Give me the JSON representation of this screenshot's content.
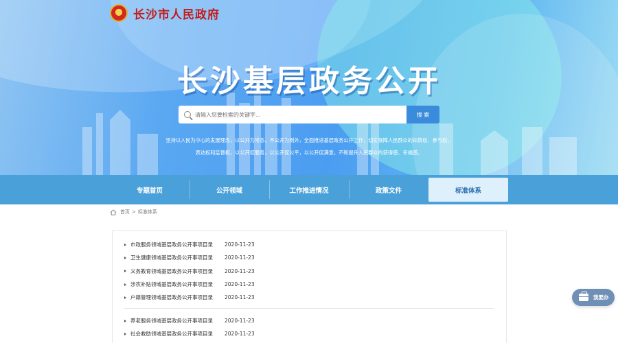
{
  "header": {
    "site_name": "长沙市人民政府",
    "headline": "长沙基层政务公开",
    "emblem_icon": "national-emblem-icon"
  },
  "search": {
    "placeholder": "请输入您要检索的关键字...",
    "button_label": "搜 索"
  },
  "motto": {
    "line1": "坚持以人民为中心的发展理念，以公开为常态，不公开为例外，全面推进基层政务公开工作，切实保障人民群众的知情权、参与权、",
    "line2": "表达权和监督权，以公开促服务，以公开促公平，以公开促满意，不断提升人民群众的获得感、幸福感。"
  },
  "nav": {
    "items": [
      {
        "label": "专题首页",
        "active": false
      },
      {
        "label": "公开领域",
        "active": false
      },
      {
        "label": "工作推进情况",
        "active": false
      },
      {
        "label": "政策文件",
        "active": false
      },
      {
        "label": "标准体系",
        "active": true
      }
    ]
  },
  "breadcrumb": {
    "home": "首页",
    "separator": ">",
    "current": "标准体系"
  },
  "list": {
    "group1": [
      {
        "title": "市政服务领域基层政务公开事项目录",
        "date": "2020-11-23"
      },
      {
        "title": "卫生健康领域基层政务公开事项目录",
        "date": "2020-11-23"
      },
      {
        "title": "义务教育领域基层政务公开事项目录",
        "date": "2020-11-23"
      },
      {
        "title": "涉农补贴领域基层政务公开事项目录",
        "date": "2020-11-23"
      },
      {
        "title": "户籍管理领域基层政务公开事项目录",
        "date": "2020-11-23"
      }
    ],
    "group2": [
      {
        "title": "养老服务领域基层政务公开事项目录",
        "date": "2020-11-23"
      },
      {
        "title": "社会救助领域基层政务公开事项目录",
        "date": "2020-11-23"
      }
    ]
  },
  "float_button": {
    "label": "我要办",
    "icon": "briefcase-icon"
  },
  "colors": {
    "banner_blue": "#4b9df1",
    "nav_blue": "#4aa0d8",
    "nav_active_bg": "#dff0fd",
    "site_name_red": "#c41a1a",
    "search_button": "#3a8bdc",
    "float_button": "#6f8fb5"
  }
}
